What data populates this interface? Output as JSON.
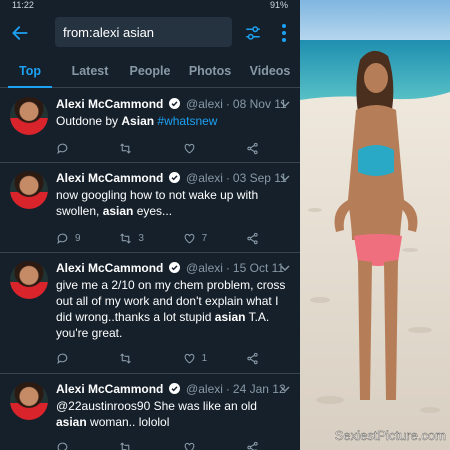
{
  "statusbar": {
    "time": "11:22",
    "right": "91%"
  },
  "search": {
    "value": "from:alexi asian"
  },
  "tabs": [
    "Top",
    "Latest",
    "People",
    "Photos",
    "Videos"
  ],
  "tweets": [
    {
      "name": "Alexi McCammond",
      "handle": "@alexi",
      "date": "08 Nov 11",
      "segments": [
        {
          "t": "Outdone by "
        },
        {
          "t": "Asian",
          "b": true
        },
        {
          "t": " "
        },
        {
          "t": "#whatsnew",
          "h": true
        }
      ],
      "replies": "",
      "retweets": "",
      "likes": ""
    },
    {
      "name": "Alexi McCammond",
      "handle": "@alexi",
      "date": "03 Sep 11",
      "segments": [
        {
          "t": "now googling how to not wake up with swollen, "
        },
        {
          "t": "asian",
          "b": true
        },
        {
          "t": " eyes..."
        }
      ],
      "replies": "9",
      "retweets": "3",
      "likes": "7"
    },
    {
      "name": "Alexi McCammond",
      "handle": "@alexi",
      "date": "15 Oct 11",
      "segments": [
        {
          "t": "give me a 2/10 on my chem problem, cross out all of my work and don't explain what I did wrong..thanks a lot stupid "
        },
        {
          "t": "asian",
          "b": true
        },
        {
          "t": " T.A. you're great."
        }
      ],
      "replies": "",
      "retweets": "",
      "likes": "1"
    },
    {
      "name": "Alexi McCammond",
      "handle": "@alexi",
      "date": "24 Jan 12",
      "segments": [
        {
          "t": "@22austinroos90 She was like an old "
        },
        {
          "t": "asian",
          "b": true
        },
        {
          "t": " woman.. lololol"
        }
      ],
      "replies": "",
      "retweets": "",
      "likes": ""
    }
  ],
  "watermark": "SexiestPicture.com",
  "colors": {
    "bg": "#15202b",
    "accent": "#1da1f2",
    "muted": "#8899a6"
  }
}
